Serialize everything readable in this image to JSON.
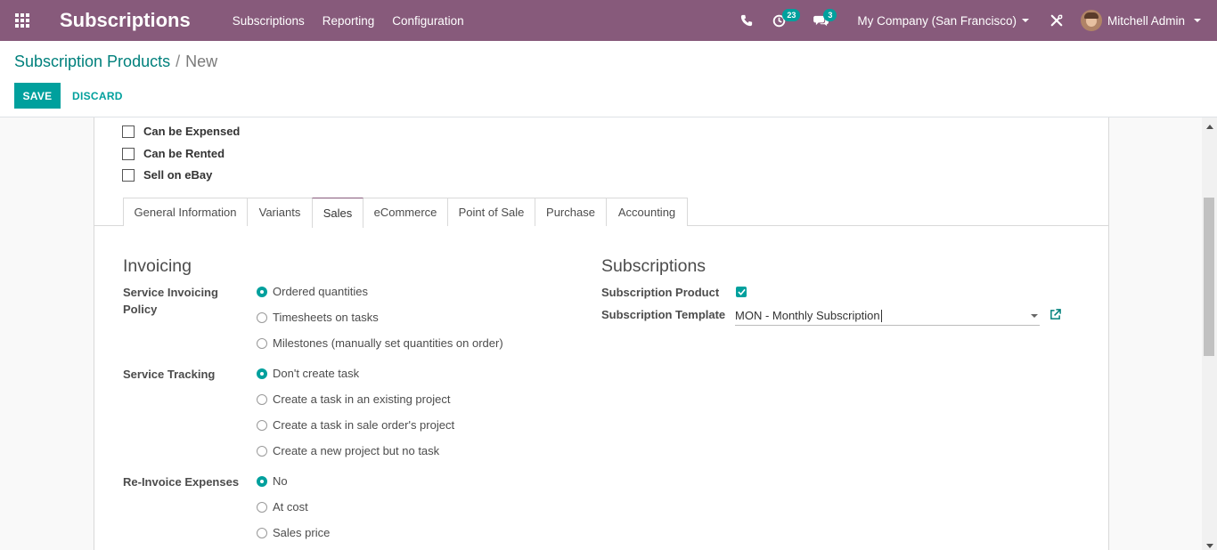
{
  "navbar": {
    "app_title": "Subscriptions",
    "menu": [
      "Subscriptions",
      "Reporting",
      "Configuration"
    ],
    "activity_count": "23",
    "message_count": "3",
    "company": "My Company (San Francisco)",
    "user": "Mitchell Admin"
  },
  "breadcrumb": {
    "parent": "Subscription Products",
    "separator": "/",
    "current": "New"
  },
  "actions": {
    "save": "SAVE",
    "discard": "DISCARD"
  },
  "product_options": [
    "Can be Expensed",
    "Can be Rented",
    "Sell on eBay"
  ],
  "tabs": [
    "General Information",
    "Variants",
    "Sales",
    "eCommerce",
    "Point of Sale",
    "Purchase",
    "Accounting"
  ],
  "active_tab": "Sales",
  "invoicing": {
    "title": "Invoicing",
    "service_invoicing_policy": {
      "label": "Service Invoicing Policy",
      "options": [
        "Ordered quantities",
        "Timesheets on tasks",
        "Milestones (manually set quantities on order)"
      ],
      "selected": "Ordered quantities"
    },
    "service_tracking": {
      "label": "Service Tracking",
      "options": [
        "Don't create task",
        "Create a task in an existing project",
        "Create a task in sale order's project",
        "Create a new project but no task"
      ],
      "selected": "Don't create task"
    },
    "reinvoice_expenses": {
      "label": "Re-Invoice Expenses",
      "options": [
        "No",
        "At cost",
        "Sales price"
      ],
      "selected": "No"
    }
  },
  "subscriptions": {
    "title": "Subscriptions",
    "product_label": "Subscription Product",
    "product_checked": true,
    "template_label": "Subscription Template",
    "template_value": "MON - Monthly Subscription"
  },
  "colors": {
    "navbar": "#875a7b",
    "primary": "#00a09d",
    "link": "#00807c"
  }
}
